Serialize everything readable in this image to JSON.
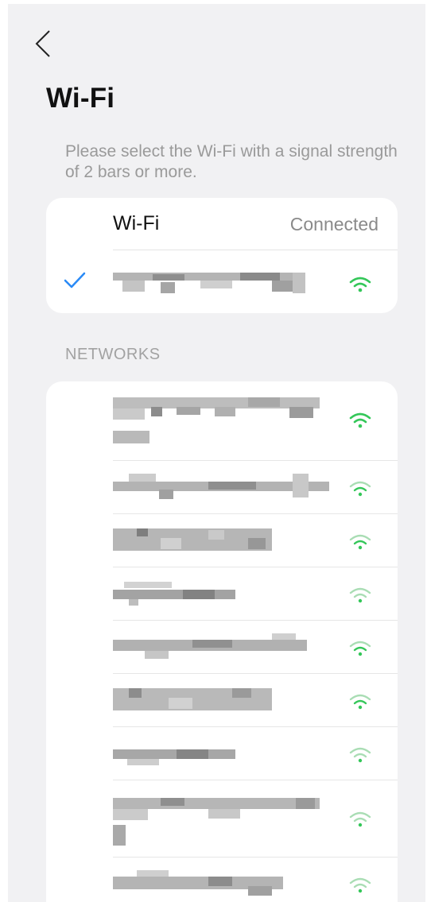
{
  "header": {
    "back_icon": "chevron-left-icon",
    "title": "Wi-Fi"
  },
  "hint": "Please select the Wi-Fi with a signal strength of 2 bars or more.",
  "current": {
    "title": "Wi-Fi",
    "status": "Connected",
    "selected_icon": "checkmark-icon",
    "signal_color": "#34c759"
  },
  "section_label": "NETWORKS",
  "networks": [
    {
      "name_hidden": true,
      "signal": "strong"
    },
    {
      "name_hidden": true,
      "signal": "weak"
    },
    {
      "name_hidden": true,
      "signal": "weak"
    },
    {
      "name_hidden": true,
      "signal": "weak"
    },
    {
      "name_hidden": true,
      "signal": "weak"
    },
    {
      "name_hidden": true,
      "signal": "weak"
    },
    {
      "name_hidden": true,
      "signal": "weak"
    },
    {
      "name_hidden": true,
      "signal": "weak"
    },
    {
      "name_hidden": true,
      "signal": "weak"
    }
  ],
  "colors": {
    "accent_blue": "#2a8af6",
    "signal_strong": "#34c759",
    "signal_weak": "#a9ddb4",
    "redacted": "#9d9d9d"
  }
}
